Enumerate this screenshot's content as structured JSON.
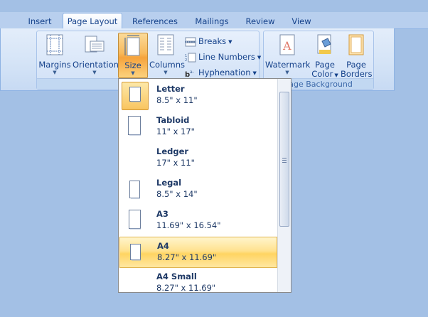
{
  "tabs": [
    {
      "label": "Insert"
    },
    {
      "label": "Page Layout"
    },
    {
      "label": "References"
    },
    {
      "label": "Mailings"
    },
    {
      "label": "Review"
    },
    {
      "label": "View"
    }
  ],
  "page_setup": {
    "margins_label": "Margins",
    "orientation_label": "Orientation",
    "size_label": "Size",
    "columns_label": "Columns",
    "breaks_label": "Breaks",
    "line_numbers_label": "Line Numbers",
    "hyphenation_label": "Hyphenation"
  },
  "page_background": {
    "group_label": "Page Background",
    "watermark_label": "Watermark",
    "page_color_label_1": "Page",
    "page_color_label_2": "Color",
    "page_borders_label_1": "Page",
    "page_borders_label_2": "Borders"
  },
  "size_menu": {
    "items": [
      {
        "name": "Letter",
        "dims": "8.5\" x 11\""
      },
      {
        "name": "Tabloid",
        "dims": "11\" x 17\""
      },
      {
        "name": "Ledger",
        "dims": "17\" x 11\""
      },
      {
        "name": "Legal",
        "dims": "8.5\" x 14\""
      },
      {
        "name": "A3",
        "dims": "11.69\" x 16.54\""
      },
      {
        "name": "A4",
        "dims": "8.27\" x 11.69\""
      },
      {
        "name": "A4 Small",
        "dims": "8.27\" x 11.69\""
      }
    ],
    "selected": "Letter",
    "hovered": "A4"
  },
  "colors": {
    "accent_orange": "#f8b95a",
    "text_blue": "#15428b",
    "background": "#a3c0e5"
  }
}
